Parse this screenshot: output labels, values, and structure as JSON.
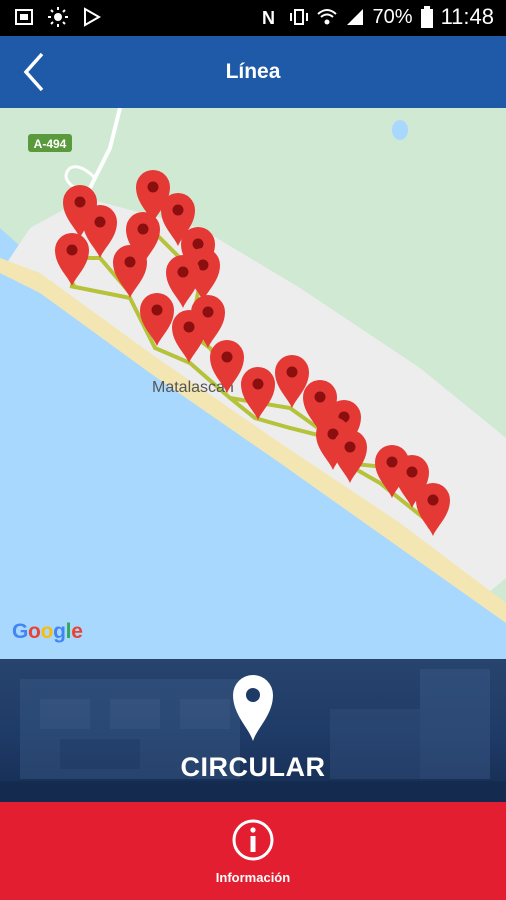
{
  "status_bar": {
    "battery": "70%",
    "time": "11:48",
    "icons": [
      "screenshot-icon",
      "brightness-icon",
      "play-store-icon",
      "nfc-icon",
      "vibrate-icon",
      "wifi-icon",
      "signal-icon",
      "battery-icon"
    ]
  },
  "header": {
    "title": "Línea",
    "back_icon": "back-arrow-icon"
  },
  "map": {
    "place_label": "Matalascañ",
    "road_label": "A-494",
    "attribution": "Google",
    "marker_count": 22,
    "colors": {
      "sea": "#a9d8ff",
      "land": "#cfe9d2",
      "town": "#eeeeee",
      "beach": "#f3e6b2",
      "route": "#b5c23a",
      "marker": "#e53935"
    }
  },
  "banner": {
    "pin_icon": "location-pin-icon",
    "label": "CIRCULAR"
  },
  "footer": {
    "info_icon": "info-icon",
    "label": "Información"
  },
  "colors": {
    "header": "#1f5aa8",
    "footer": "#e31e30"
  }
}
